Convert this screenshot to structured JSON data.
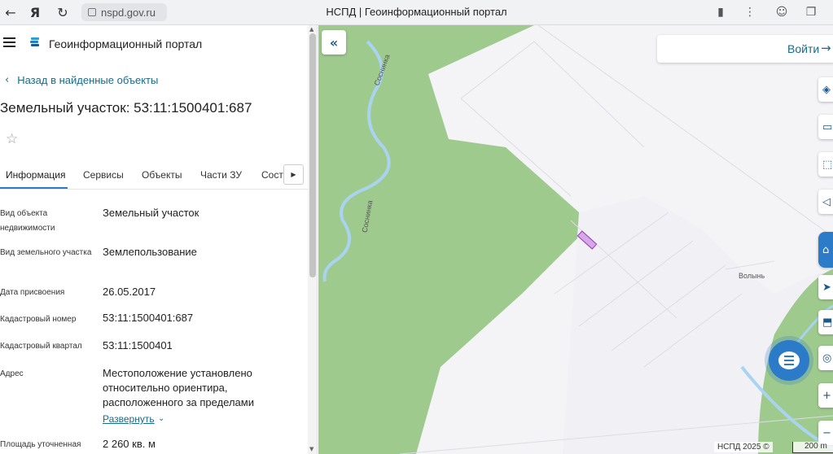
{
  "browser": {
    "address": "nspd.gov.ru",
    "tab_title": "НСПД | Геоинформационный портал",
    "icons": [
      "back-arrow-icon",
      "yandex-icon",
      "reload-icon",
      "lock-icon",
      "bookmark-icon",
      "menu-dots-icon",
      "avatar-icon",
      "collections-icon"
    ]
  },
  "header": {
    "portal_title": "Геоинформационный портал"
  },
  "panel": {
    "back_label": "Назад в найденные объекты",
    "object_title": "Земельный участок: 53:11:1500401:687",
    "tabs": [
      {
        "label": "Информация",
        "active": true
      },
      {
        "label": "Сервисы"
      },
      {
        "label": "Объекты"
      },
      {
        "label": "Части ЗУ"
      },
      {
        "label": "Соста"
      }
    ],
    "rows": [
      {
        "label": "Вид объекта недвижимости",
        "value": "Земельный участок"
      },
      {
        "label": "Вид земельного участка",
        "value": "Землепользование"
      },
      {
        "label": "Дата присвоения",
        "value": "26.05.2017"
      },
      {
        "label": "Кадастровый номер",
        "value": "53:11:1500401:687"
      },
      {
        "label": "Кадастровый квартал",
        "value": "53:11:1500401"
      },
      {
        "label": "Адрес",
        "value": "Местоположение установлено относительно ориентира, расположенного за пределами"
      },
      {
        "label": "Площадь уточненная",
        "value": "2 260 кв. м"
      }
    ],
    "expand_label": "Развернуть"
  },
  "map": {
    "login_label": "Войти",
    "attribution": "НСПД 2025 ©",
    "scale_label": "200 m",
    "place_label": "Волынь",
    "river_label": "Соснинка",
    "colors": {
      "forest": "#9fca8e",
      "field": "#f4f4f7",
      "river": "#a9d3ef",
      "parcel": "#d5a9e8",
      "accent": "#2b7bc8"
    }
  }
}
